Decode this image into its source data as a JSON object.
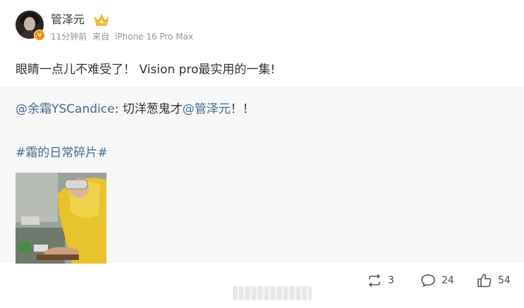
{
  "post": {
    "username": "管泽元",
    "time": "11分钟前",
    "source_prefix": "来自",
    "source": "iPhone 16 Pro Max",
    "text": "眼睛一点儿不难受了！ Vision pro最实用的一集!",
    "verified_badge": "v"
  },
  "repost": {
    "mention_author": "@余霜YSCandice",
    "colon": ": ",
    "content": "切洋葱鬼才",
    "mention_target": "@管泽元",
    "ending": "！！",
    "hashtag": "#霜的日常碎片#"
  },
  "actions": {
    "repost_count": "3",
    "comment_count": "24",
    "like_count": "54"
  },
  "colors": {
    "link": "#466b94",
    "meta": "#939393",
    "repost_bg": "#f7f7f7",
    "text": "#333333"
  },
  "icons": {
    "member": "crown-badge-icon",
    "verified": "verified-v-icon",
    "repost": "repost-icon",
    "comment": "comment-icon",
    "like": "thumbs-up-icon"
  }
}
